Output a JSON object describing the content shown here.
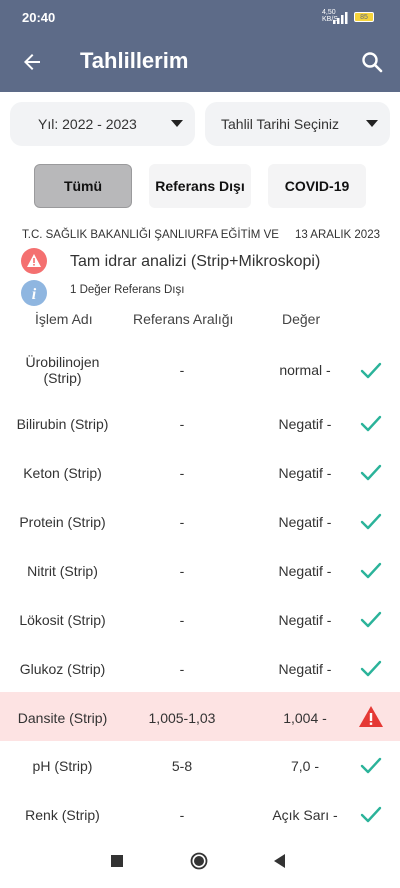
{
  "status_bar": {
    "time": "20:40",
    "network": "4,50\nKB/S",
    "battery": "85"
  },
  "app_bar": {
    "title": "Tahlillerim"
  },
  "filters": {
    "year_dropdown": "Yıl: 2022 - 2023",
    "date_dropdown": "Tahlil Tarihi Seçiniz",
    "buttons": [
      "Tümü",
      "Referans Dışı",
      "COVID-19"
    ]
  },
  "report": {
    "institution": "T.C. SAĞLIK BAKANLIĞI ŞANLIURFA EĞİTİM VE",
    "date": "13 ARALIK 2023",
    "test_name": "Tam idrar analizi (Strip+Mikroskopi)",
    "out_of_range_note": "1 Değer Referans Dışı"
  },
  "table": {
    "headers": [
      "İşlem Adı",
      "Referans Aralığı",
      "Değer"
    ],
    "rows": [
      {
        "name": "Ürobilinojen (Strip)",
        "range": "-",
        "value": "normal -",
        "status": "ok"
      },
      {
        "name": "Bilirubin (Strip)",
        "range": "-",
        "value": "Negatif -",
        "status": "ok"
      },
      {
        "name": "Keton (Strip)",
        "range": "-",
        "value": "Negatif -",
        "status": "ok"
      },
      {
        "name": "Protein (Strip)",
        "range": "-",
        "value": "Negatif -",
        "status": "ok"
      },
      {
        "name": "Nitrit (Strip)",
        "range": "-",
        "value": "Negatif -",
        "status": "ok"
      },
      {
        "name": "Lökosit (Strip)",
        "range": "-",
        "value": "Negatif -",
        "status": "ok"
      },
      {
        "name": "Glukoz (Strip)",
        "range": "-",
        "value": "Negatif -",
        "status": "ok"
      },
      {
        "name": "Dansite (Strip)",
        "range": "1,005-1,03",
        "value": "1,004 -",
        "status": "alert"
      },
      {
        "name": "pH (Strip)",
        "range": "5-8",
        "value": "7,0 -",
        "status": "ok"
      },
      {
        "name": "Renk (Strip)",
        "range": "-",
        "value": "Açık Sarı -",
        "status": "ok"
      }
    ]
  },
  "colors": {
    "header": "#5d6b88",
    "check": "#2bb39a",
    "alert": "#e53935",
    "alert_row": "#fde3e3"
  }
}
